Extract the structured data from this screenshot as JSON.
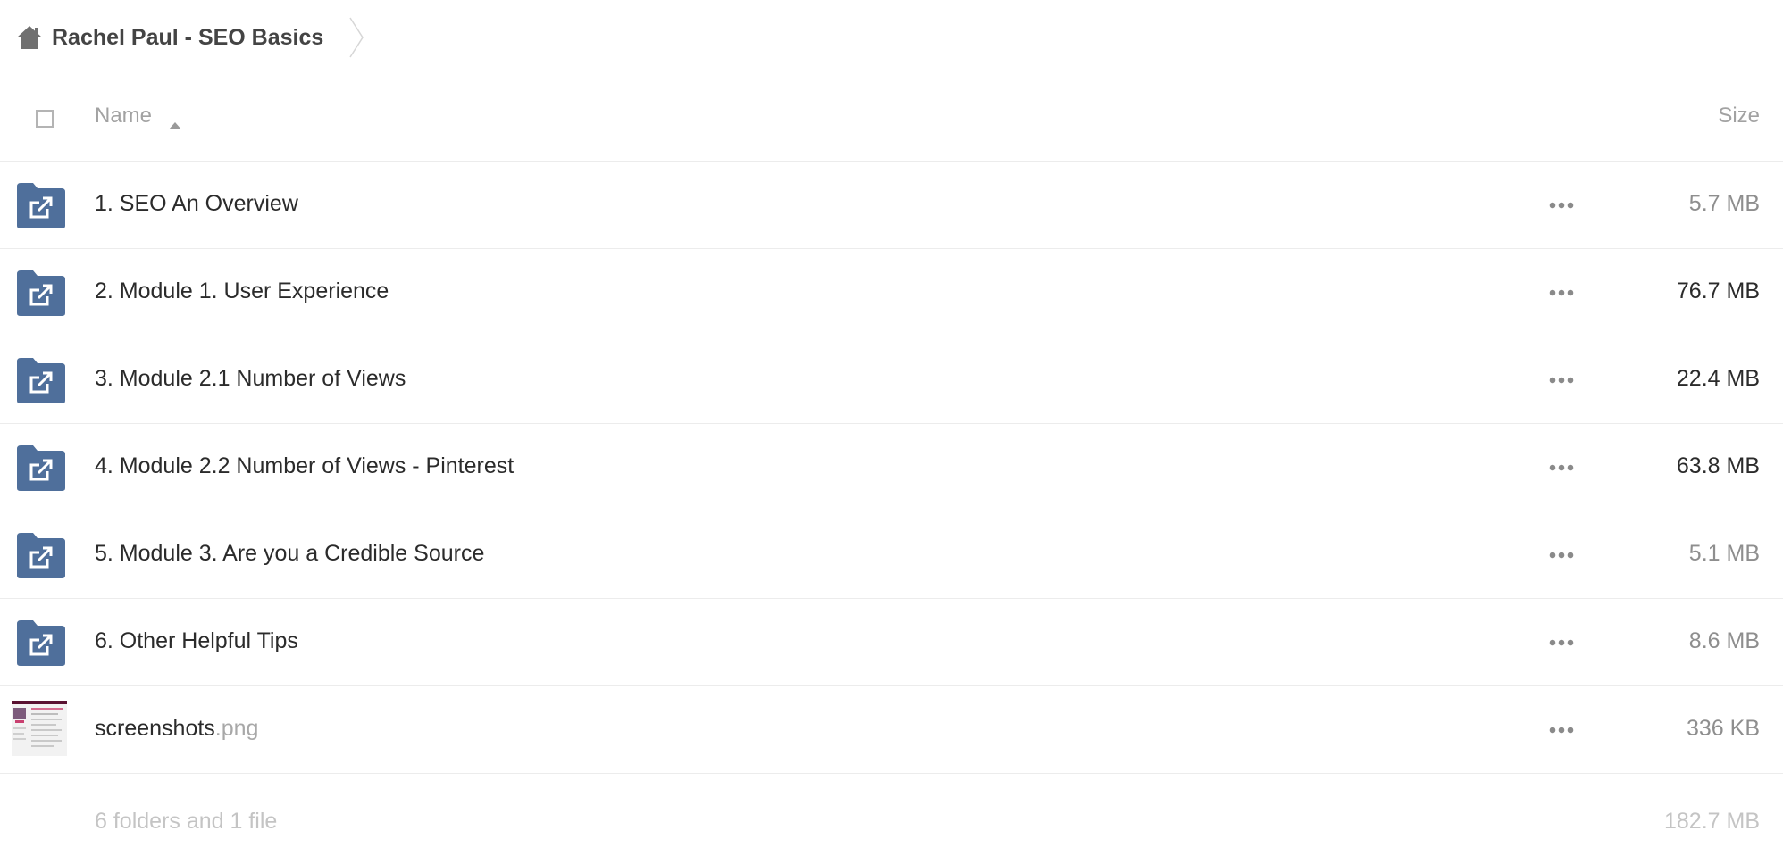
{
  "breadcrumb": {
    "home_icon": "home-icon",
    "current": "Rachel Paul - SEO Basics"
  },
  "header": {
    "name_label": "Name",
    "size_label": "Size",
    "sort": "ascending"
  },
  "rows": [
    {
      "name": "1. SEO An Overview",
      "ext": "",
      "size": "5.7 MB",
      "type": "shared-folder",
      "icon": "shared-folder-icon"
    },
    {
      "name": "2. Module 1. User Experience",
      "ext": "",
      "size": "76.7 MB",
      "type": "shared-folder",
      "icon": "shared-folder-icon"
    },
    {
      "name": "3. Module 2.1 Number of Views",
      "ext": "",
      "size": "22.4 MB",
      "type": "shared-folder",
      "icon": "shared-folder-icon"
    },
    {
      "name": "4. Module 2.2 Number of Views - Pinterest",
      "ext": "",
      "size": "63.8 MB",
      "type": "shared-folder",
      "icon": "shared-folder-icon"
    },
    {
      "name": "5. Module 3. Are you a Credible Source",
      "ext": "",
      "size": "5.1 MB",
      "type": "shared-folder",
      "icon": "shared-folder-icon"
    },
    {
      "name": "6. Other Helpful Tips",
      "ext": "",
      "size": "8.6 MB",
      "type": "shared-folder",
      "icon": "shared-folder-icon"
    },
    {
      "name": "screenshots",
      "ext": ".png",
      "size": "336 KB",
      "type": "image",
      "icon": "image-thumbnail"
    }
  ],
  "summary": {
    "count": "6 folders and 1 file",
    "total": "182.7 MB"
  },
  "colors": {
    "folder": "#4f6f9b",
    "muted_text": "#a2a2a2",
    "divider": "#ececec"
  }
}
